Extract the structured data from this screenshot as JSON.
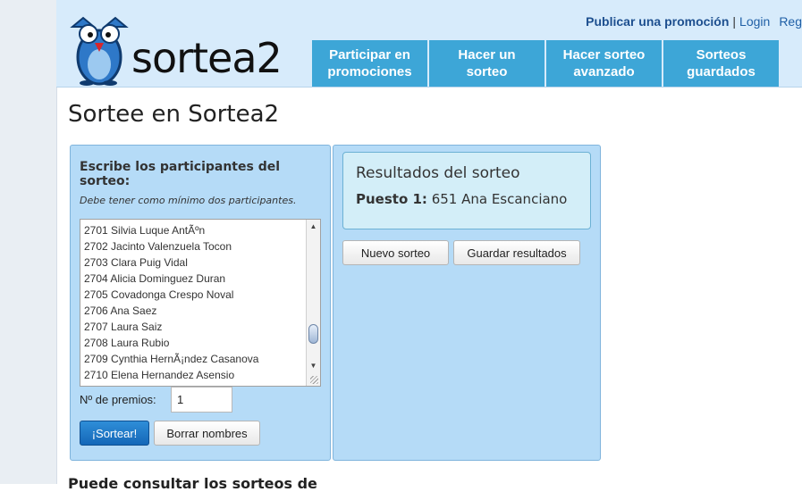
{
  "header": {
    "logo_text": "sortea2",
    "links": {
      "publicar": "Publicar una promoción",
      "separator": "|",
      "login": "Login",
      "register": "Reg"
    },
    "nav_tabs": [
      {
        "line1": "Participar en",
        "line2": "promociones"
      },
      {
        "line1": "Hacer un",
        "line2": "sorteo"
      },
      {
        "line1": "Hacer sorteo",
        "line2": "avanzado"
      },
      {
        "line1": "Sorteos",
        "line2": "guardados"
      }
    ]
  },
  "page": {
    "title": "Sortee en Sortea2",
    "bottom_heading": "Puede consultar los sorteos de"
  },
  "participants": {
    "heading": "Escribe los participantes del sorteo:",
    "note": "Debe tener como mínimo dos participantes.",
    "names": [
      "2701 Silvia Luque AntÃºn",
      "2702 Jacinto Valenzuela Tocon",
      "2703 Clara Puig Vidal",
      "2704 Alicia Dominguez Duran",
      "2705 Covadonga Crespo Noval",
      "2706 Ana Saez",
      "2707 Laura Saiz",
      "2708 Laura Rubio",
      "2709 Cynthia HernÃ¡ndez Casanova",
      "2710 Elena Hernandez Asensio"
    ],
    "prize_label": "Nº de premios:",
    "prize_value": "1",
    "draw_button": "¡Sortear!",
    "clear_button": "Borrar nombres"
  },
  "results": {
    "heading": "Resultados del sorteo",
    "winner_label": "Puesto 1:",
    "winner_value": "651 Ana Escanciano",
    "new_button": "Nuevo sorteo",
    "save_button": "Guardar resultados"
  },
  "colors": {
    "nav_tab": "#3da6d7",
    "panel": "#b5dbf7",
    "header_bg": "#d7ebfb",
    "primary_button": "#1d74c4"
  }
}
